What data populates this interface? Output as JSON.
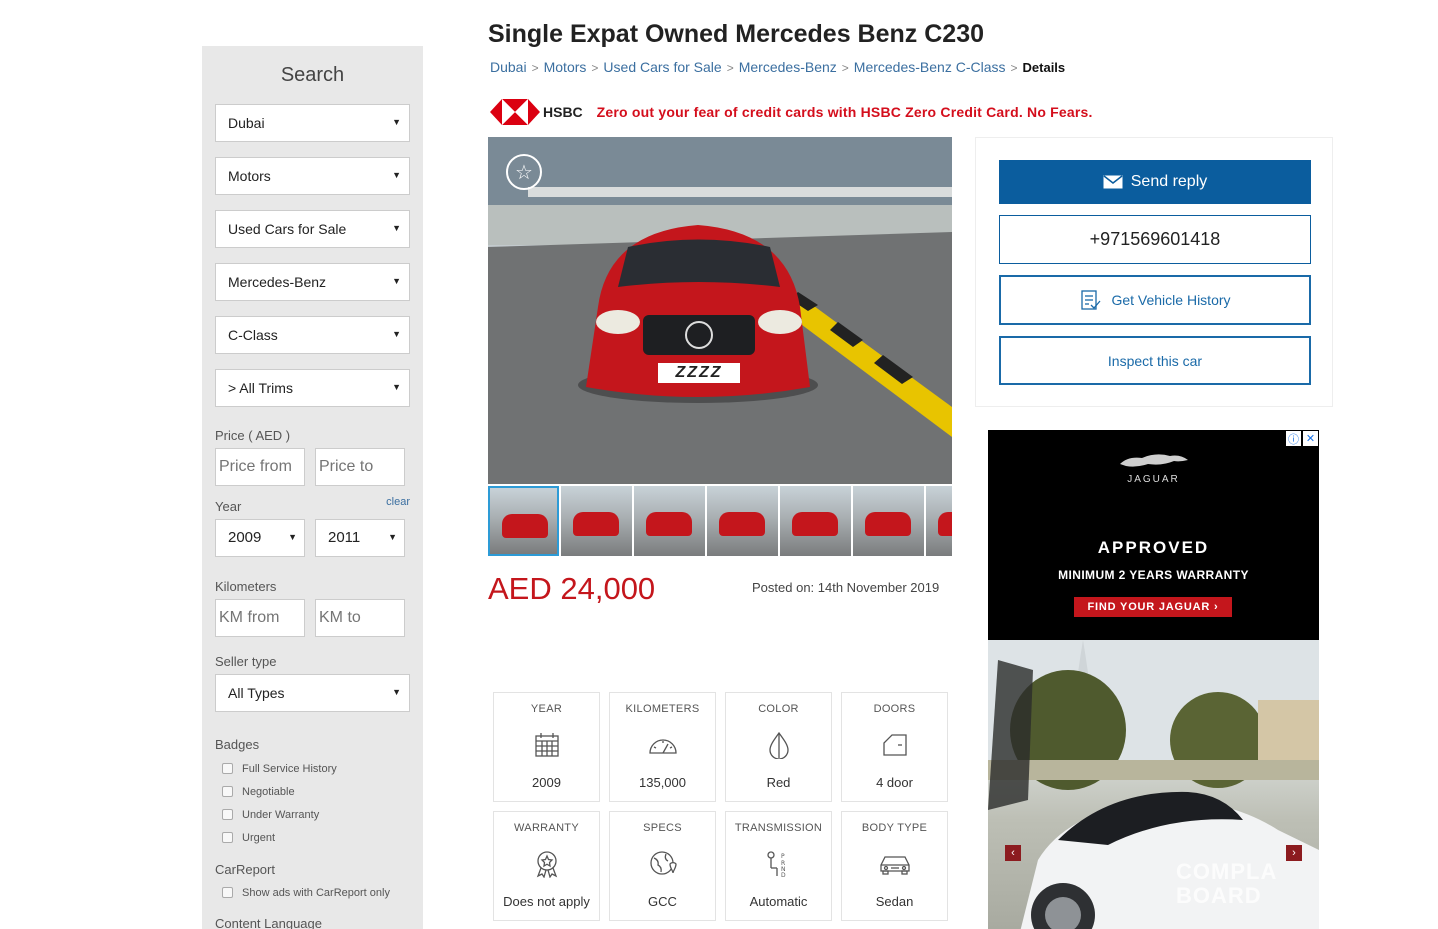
{
  "sidebar": {
    "title": "Search",
    "selects": [
      {
        "value": "Dubai"
      },
      {
        "value": "Motors"
      },
      {
        "value": "Used Cars for Sale"
      },
      {
        "value": "Mercedes-Benz"
      },
      {
        "value": "C-Class"
      },
      {
        "value": "> All Trims"
      }
    ],
    "price_label": "Price ( AED )",
    "price_from_placeholder": "Price from",
    "price_to_placeholder": "Price to",
    "year_label": "Year",
    "year_clear": "clear",
    "year_from": "2009",
    "year_to": "2011",
    "km_label": "Kilometers",
    "km_from_placeholder": "KM from",
    "km_to_placeholder": "KM to",
    "seller_label": "Seller type",
    "seller_value": "All Types",
    "badges_label": "Badges",
    "badges": [
      "Full Service History",
      "Negotiable",
      "Under Warranty",
      "Urgent"
    ],
    "carreport_label": "CarReport",
    "carreport_option": "Show ads with CarReport only",
    "content_language_label": "Content Language"
  },
  "listing": {
    "title": "Single Expat Owned Mercedes Benz C230",
    "breadcrumbs": [
      "Dubai",
      "Motors",
      "Used Cars for Sale",
      "Mercedes-Benz",
      "Mercedes-Benz C-Class"
    ],
    "breadcrumb_current": "Details",
    "breadcrumb_sep": ">",
    "price": "AED 24,000",
    "posted": "Posted on: 14th November 2019",
    "plate": "ZZZZ"
  },
  "hsbc_ad": {
    "brand": "HSBC",
    "text": "Zero out your fear of credit cards with HSBC Zero Credit Card. No Fears."
  },
  "specs": [
    {
      "label": "YEAR",
      "value": "2009",
      "icon": "calendar-icon"
    },
    {
      "label": "KILOMETERS",
      "value": "135,000",
      "icon": "speedometer-icon"
    },
    {
      "label": "COLOR",
      "value": "Red",
      "icon": "color-drop-icon"
    },
    {
      "label": "DOORS",
      "value": "4 door",
      "icon": "door-icon"
    },
    {
      "label": "WARRANTY",
      "value": "Does not apply",
      "icon": "warranty-badge-icon"
    },
    {
      "label": "SPECS",
      "value": "GCC",
      "icon": "globe-pin-icon"
    },
    {
      "label": "TRANSMISSION",
      "value": "Automatic",
      "icon": "gear-shift-icon"
    },
    {
      "label": "BODY TYPE",
      "value": "Sedan",
      "icon": "sedan-icon"
    }
  ],
  "contact": {
    "send_reply": "Send reply",
    "phone": "+971569601418",
    "vehicle_history": "Get Vehicle History",
    "inspect": "Inspect this car"
  },
  "jaguar_ad": {
    "brand": "JAGUAR",
    "approved": "APPROVED",
    "warranty": "MINIMUM 2 YEARS WARRANTY",
    "cta": "FIND YOUR JAGUAR  ›",
    "info_icon": "ⓘ",
    "close_icon": "✕",
    "watermark_line1": "COMPLA",
    "watermark_line2": "BOARD"
  },
  "colors": {
    "brand_blue": "#0b5d9e",
    "price_red": "#c4161c",
    "hsbc_red": "#d40e1c",
    "sidebar_bg": "#e8e8e8"
  }
}
